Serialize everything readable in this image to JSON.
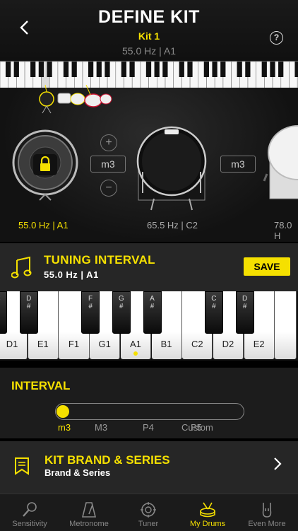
{
  "header": {
    "title": "DEFINE KIT",
    "kit_name": "Kit 1",
    "current_note": "55.0 Hz | A1",
    "help_label": "?"
  },
  "drums": [
    {
      "freq": "55.0 Hz | A1",
      "active": true,
      "locked": true
    },
    {
      "freq": "65.5 Hz | C2",
      "active": false,
      "locked": false
    },
    {
      "freq": "78.0 H",
      "active": false,
      "locked": false
    }
  ],
  "interval_controls": {
    "left_interval": "m3",
    "right_interval": "m3",
    "plus": "+",
    "minus": "−"
  },
  "tuning": {
    "title": "TUNING INTERVAL",
    "subtitle": "55.0 Hz | A1",
    "save_label": "SAVE"
  },
  "keyboard": {
    "white_keys": [
      "D1",
      "E1",
      "F1",
      "G1",
      "A1",
      "B1",
      "C2",
      "D2",
      "E2"
    ],
    "black_keys": [
      "C\n#",
      "D\n#",
      "F\n#",
      "G\n#",
      "A\n#",
      "C\n#",
      "D\n#"
    ],
    "selected": "A1"
  },
  "interval": {
    "title": "INTERVAL",
    "ticks": [
      "m3",
      "M3",
      "P4",
      "Custom",
      "P5"
    ],
    "selected": "m3",
    "value_fraction": 0
  },
  "brand": {
    "title": "KIT BRAND & SERIES",
    "subtitle": "Brand & Series"
  },
  "tabs": [
    {
      "label": "Sensitivity",
      "icon": "microphone-icon",
      "active": false
    },
    {
      "label": "Metronome",
      "icon": "metronome-icon",
      "active": false
    },
    {
      "label": "Tuner",
      "icon": "tuner-icon",
      "active": false
    },
    {
      "label": "My Drums",
      "icon": "drums-icon",
      "active": true
    },
    {
      "label": "Even More",
      "icon": "rock-hand-icon",
      "active": false
    }
  ],
  "colors": {
    "accent": "#f5e000",
    "background": "#000000",
    "panel": "#262626"
  }
}
